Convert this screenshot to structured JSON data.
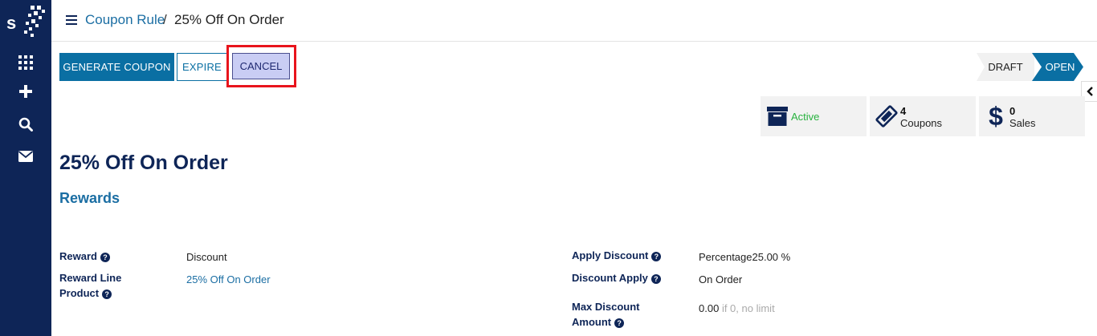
{
  "sidebar": {
    "logo": "SF",
    "icons": [
      "apps-grid-icon",
      "plus-icon",
      "search-icon",
      "mail-icon"
    ]
  },
  "breadcrumb": {
    "parent": "Coupon Rule",
    "separator": "/",
    "current": "25% Off On Order"
  },
  "actions": {
    "generate": "GENERATE COUPON",
    "expire": "EXPIRE",
    "cancel": "CANCEL"
  },
  "status": {
    "draft": "DRAFT",
    "open": "OPEN",
    "current": "OPEN"
  },
  "smart_buttons": {
    "active": "Active",
    "coupons_count": "4",
    "coupons_label": "Coupons",
    "sales_count": "0",
    "sales_label": "Sales"
  },
  "record": {
    "title": "25% Off On Order",
    "section": "Rewards"
  },
  "fields": {
    "reward_label": "Reward",
    "reward_value": "Discount",
    "reward_line_label_1": "Reward Line",
    "reward_line_label_2": "Product",
    "reward_line_value": "25% Off On Order",
    "apply_discount_label": "Apply Discount",
    "apply_discount_value": "Percentage25.00 %",
    "discount_apply_label": "Discount Apply",
    "discount_apply_value": "On Order",
    "max_discount_label_1": "Max Discount",
    "max_discount_label_2": "Amount",
    "max_discount_value": "0.00",
    "max_discount_hint": "if 0, no limit"
  },
  "colors": {
    "sidebar": "#0e2557",
    "primary": "#0a6fa3",
    "highlight": "#e8141c",
    "active": "#27b23e"
  }
}
